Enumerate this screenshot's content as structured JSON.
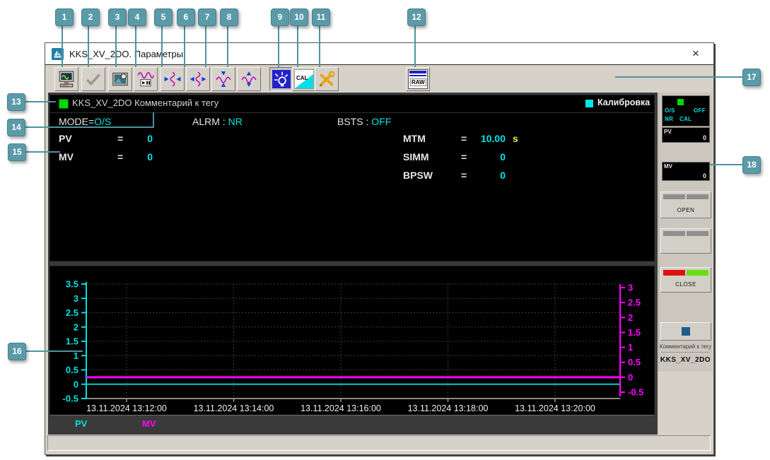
{
  "callouts": {
    "color": "#5B9AA8",
    "numbers": [
      "1",
      "2",
      "3",
      "4",
      "5",
      "6",
      "7",
      "8",
      "9",
      "10",
      "11",
      "12",
      "13",
      "14",
      "15",
      "16",
      "17",
      "18"
    ]
  },
  "window": {
    "title": "KKS_XV_2DO. Параметры",
    "close_glyph": "×"
  },
  "toolbar": {
    "buttons": [
      {
        "icon": "print-screen-icon"
      },
      {
        "icon": "confirm-check-icon"
      },
      {
        "icon": "snapshot-icon"
      },
      {
        "icon": "trend-run-pause-icon"
      },
      {
        "icon": "compress-time-icon"
      },
      {
        "icon": "expand-time-icon"
      },
      {
        "icon": "compress-scale-icon"
      },
      {
        "icon": "expand-scale-icon"
      },
      {
        "icon": "alarm-lamp-icon"
      },
      {
        "icon": "calibration-icon",
        "label": "CAL"
      },
      {
        "icon": "tools-icon"
      },
      {
        "icon": "raw-data-icon",
        "label": "RAW"
      }
    ]
  },
  "params": {
    "indicator_color": "#00D800",
    "tag_comment": "KKS_XV_2DO Комментарий к тегу",
    "calibration_label": "Калибровка",
    "calibration_color": "#00E5E5",
    "mode": {
      "label": "MODE=",
      "value": "O/S"
    },
    "alrm": {
      "label": "ALRM :",
      "value": "NR"
    },
    "bsts": {
      "label": "BSTS :",
      "value": "OFF"
    },
    "left_rows": [
      {
        "label": "PV",
        "eq": "=",
        "value": "0",
        "unit": ""
      },
      {
        "label": "MV",
        "eq": "=",
        "value": "0",
        "unit": ""
      }
    ],
    "right_rows": [
      {
        "label": "MTM",
        "eq": "=",
        "value": "10.00",
        "unit": "s"
      },
      {
        "label": "SIMM",
        "eq": "=",
        "value": "0",
        "unit": ""
      },
      {
        "label": "BPSW",
        "eq": "=",
        "value": "0",
        "unit": ""
      }
    ]
  },
  "chart_data": {
    "type": "line",
    "title": "",
    "x_labels": [
      "13.11.2024 13:12:00",
      "13.11.2024 13:14:00",
      "13.11.2024 13:16:00",
      "13.11.2024 13:18:00",
      "13.11.2024 13:20:00"
    ],
    "left_axis": {
      "min": -0.5,
      "max": 3.5,
      "step": 0.5,
      "ticks": [
        3.5,
        3,
        2.5,
        2,
        1.5,
        1,
        0.5,
        0,
        -0.5
      ],
      "color": "#00E0E0"
    },
    "right_axis": {
      "min": -0.5,
      "max": 3,
      "step": 0.5,
      "ticks": [
        3,
        2.5,
        2,
        1.5,
        1,
        0.5,
        0,
        -0.5
      ],
      "color": "#FF00FF"
    },
    "grid": true,
    "background": "#000000",
    "legend_position": "bottom",
    "series": [
      {
        "name": "PV",
        "axis": "left",
        "color": "#00CCCC",
        "values": [
          0,
          0,
          0,
          0,
          0
        ]
      },
      {
        "name": "MV",
        "axis": "right",
        "color": "#FF00FF",
        "values": [
          0,
          0,
          0,
          0,
          0
        ]
      }
    ]
  },
  "legend": {
    "pv": "PV",
    "mv": "MV"
  },
  "faceplate": {
    "status": {
      "mode": "O/S",
      "state": "OFF",
      "alarm": "NR",
      "cal": "CAL",
      "indicator_color": "#00D800"
    },
    "pv": {
      "label": "PV",
      "value": "0"
    },
    "mv": {
      "label": "MV",
      "value": "0"
    },
    "open_button": "OPEN",
    "close_button": "CLOSE",
    "comment": "Комментарий к тегу",
    "tag": "KKS_XV_2DO"
  }
}
